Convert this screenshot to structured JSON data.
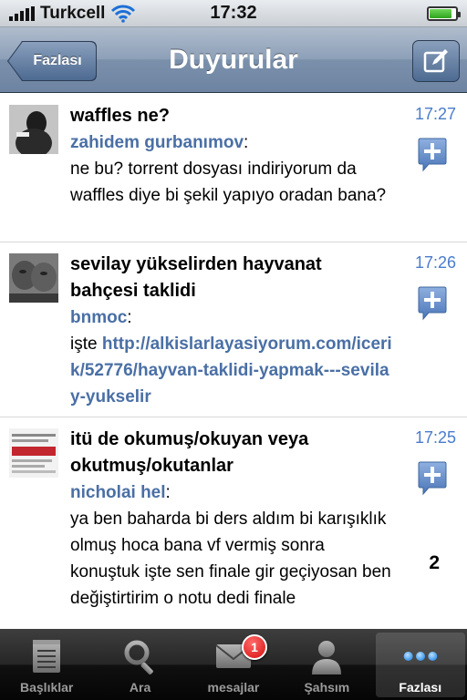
{
  "status": {
    "carrier": "Turkcell",
    "time": "17:32",
    "battery_level": 0.85
  },
  "nav": {
    "back_label": "Fazlası",
    "title": "Duyurular",
    "compose_icon": "compose-icon"
  },
  "items": [
    {
      "title": "waffles ne?",
      "author": "zahidem gurbanımov",
      "colon": ":",
      "body": "ne bu? torrent dosyası indiriyorum da waffles diye bi şekil yapıyo oradan bana?",
      "time": "17:27"
    },
    {
      "title": "sevilay yükselirden hayvanat bahçesi taklidi",
      "author": "bnmoc",
      "colon": ":",
      "body_prefix": "işte ",
      "link": "http://alkislarlayasiyorum.com/icerik/52776/hayvan-taklidi-yapmak---sevilay-yukselir",
      "time": "17:26"
    },
    {
      "title": "itü de okumuş/okuyan veya okutmuş/okutanlar",
      "author": "nicholai hel",
      "colon": ":",
      "body": "ya ben baharda bi ders aldım bi karışıklık olmuş hoca bana vf vermiş sonra konuştuk işte sen finale gir geçiyosan ben değiştirtirim o notu dedi finale",
      "time": "17:25",
      "count": "2"
    }
  ],
  "tabs": [
    {
      "label": "Başlıklar",
      "icon": "notepad-icon",
      "active": false
    },
    {
      "label": "Ara",
      "icon": "search-icon",
      "active": false
    },
    {
      "label": "mesajlar",
      "icon": "envelope-icon",
      "active": false,
      "badge": "1"
    },
    {
      "label": "Şahsım",
      "icon": "person-icon",
      "active": false
    },
    {
      "label": "Fazlası",
      "icon": "more-dots-icon",
      "active": true
    }
  ],
  "colors": {
    "link": "#4a6fa5",
    "time": "#4a7ccd",
    "nav": "#6d84a2",
    "badge": "#d50f0f"
  }
}
